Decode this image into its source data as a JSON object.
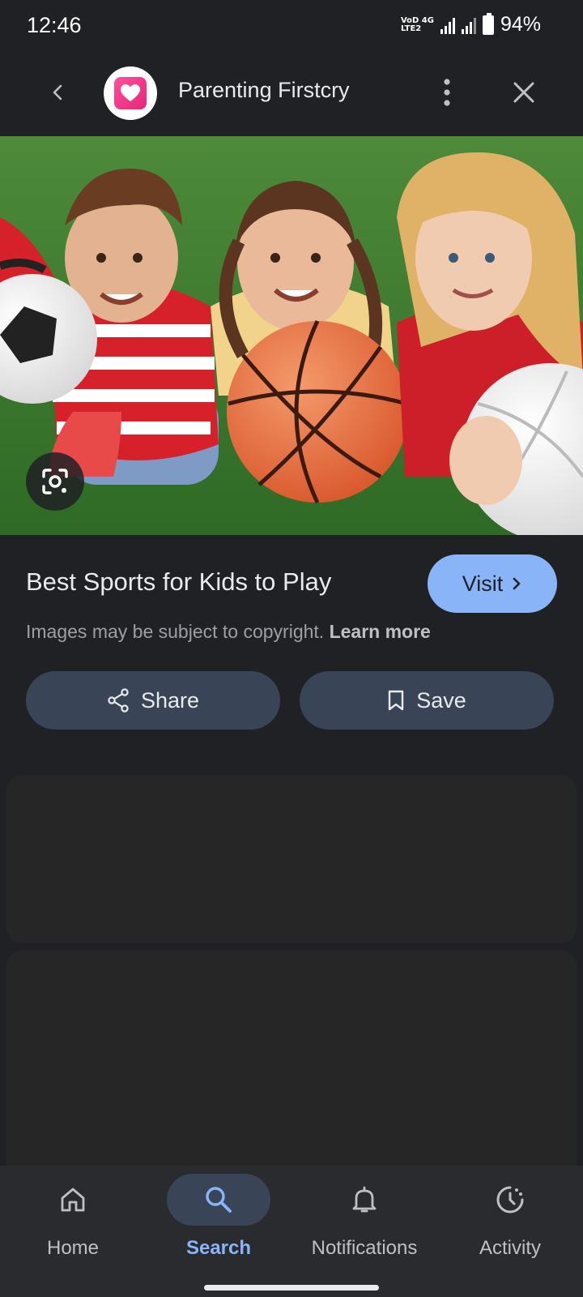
{
  "status_bar": {
    "time": "12:46",
    "network_top": "VoD 4G",
    "network_bottom": "LTE2",
    "battery": "94%"
  },
  "app_bar": {
    "site_name": "Parenting Firstcry",
    "back_icon": "chevron-left-icon",
    "more_icon": "more-vert-icon",
    "close_icon": "close-icon"
  },
  "result": {
    "title": "Best Sports for Kids to Play",
    "visit_label": "Visit",
    "copyright_text": "Images may be subject to copyright.",
    "learn_more": "Learn more",
    "share_label": "Share",
    "save_label": "Save"
  },
  "bottom_nav": {
    "items": [
      {
        "label": "Home",
        "icon": "home-icon",
        "active": false
      },
      {
        "label": "Search",
        "icon": "search-icon",
        "active": true
      },
      {
        "label": "Notifications",
        "icon": "bell-icon",
        "active": false
      },
      {
        "label": "Activity",
        "icon": "activity-icon",
        "active": false
      }
    ]
  },
  "colors": {
    "background": "#202124",
    "accent": "#8ab4f8",
    "button_bg": "#394457",
    "brand_pink": "#e5267a"
  }
}
